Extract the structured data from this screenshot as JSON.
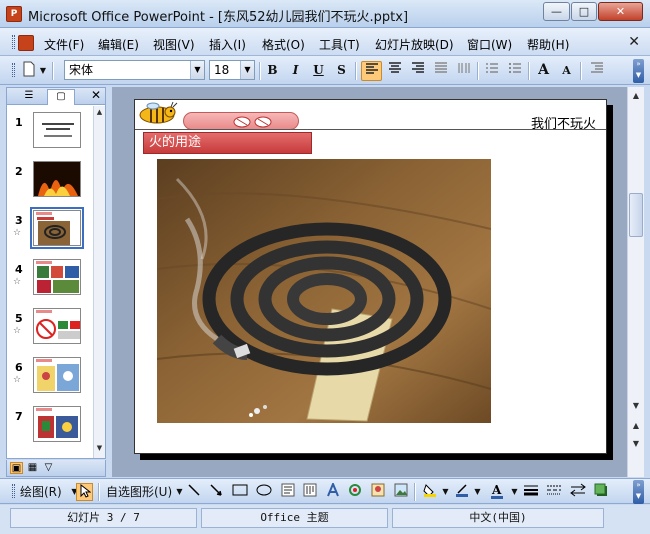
{
  "window": {
    "app_icon_text": "P",
    "title": "Microsoft Office PowerPoint - [东风52幼儿园我们不玩火.pptx]",
    "minimize": "—",
    "maximize": "□",
    "close": "✕"
  },
  "menu": {
    "items": [
      "文件(F)",
      "编辑(E)",
      "视图(V)",
      "插入(I)",
      "格式(O)",
      "工具(T)",
      "幻灯片放映(D)",
      "窗口(W)",
      "帮助(H)"
    ],
    "close_glyph": "✕"
  },
  "format_toolbar": {
    "font_name": "宋体",
    "font_size": "18",
    "bold": "B",
    "italic": "I",
    "underline": "U",
    "shadow": "S",
    "align_left_active": true,
    "increase_font": "A",
    "decrease_font": "A"
  },
  "left_pane": {
    "tab_outline": "☰",
    "tab_slides": "▢",
    "close": "✕",
    "slides": [
      {
        "num": "1",
        "star": ""
      },
      {
        "num": "2",
        "star": ""
      },
      {
        "num": "3",
        "star": "☆"
      },
      {
        "num": "4",
        "star": "☆"
      },
      {
        "num": "5",
        "star": "☆"
      },
      {
        "num": "6",
        "star": "☆"
      },
      {
        "num": "7",
        "star": ""
      }
    ],
    "selected_slide": 3
  },
  "slide": {
    "header_text": "我们不玩火",
    "subtitle": "火的用途"
  },
  "draw_toolbar": {
    "draw_label": "绘图(R)",
    "autoshapes_label": "自选图形(U)"
  },
  "status": {
    "slide_info": "幻灯片 3 / 7",
    "theme": "Office 主题",
    "language": "中文(中国)"
  },
  "colors": {
    "accent": "#3d6fc1",
    "subtitle_red": "#c73b3b",
    "toolbar_active": "#ffc97a"
  }
}
